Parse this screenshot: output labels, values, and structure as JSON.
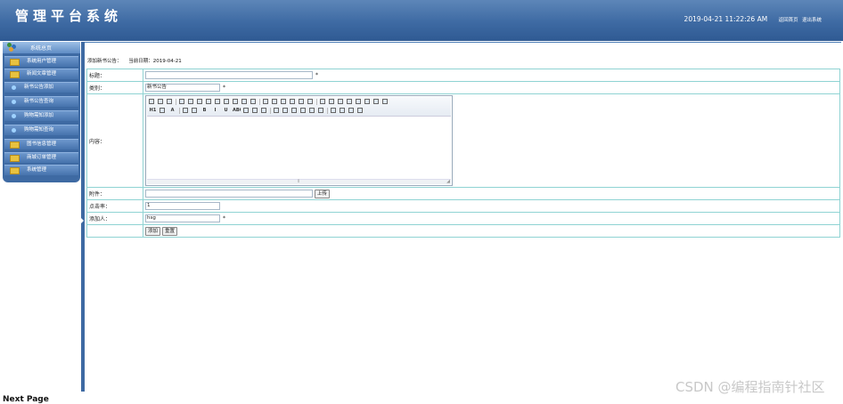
{
  "header": {
    "title": "管理平台系统",
    "datetime": "2019-04-21 11:22:26 AM",
    "links": [
      "返回首页",
      "退出系统"
    ]
  },
  "sidebar": {
    "header_label": "系统总页",
    "items": [
      {
        "label": "系统用户管理",
        "icon": "folder-icon"
      },
      {
        "label": "新闻文章管理",
        "icon": "folder-icon"
      },
      {
        "label": "新书公告添加",
        "icon": "bullet-icon"
      },
      {
        "label": "新书公告查询",
        "icon": "bullet-icon"
      },
      {
        "label": "购物需知添加",
        "icon": "bullet-icon"
      },
      {
        "label": "购物需知查询",
        "icon": "bullet-icon"
      },
      {
        "label": "图书信息管理",
        "icon": "folder-icon"
      },
      {
        "label": "商城订单管理",
        "icon": "folder-icon"
      },
      {
        "label": "系统管理",
        "icon": "folder-icon"
      }
    ]
  },
  "page": {
    "breadcrumb": "添加新书公告：",
    "date_label": "当前日期：",
    "date_value": "2019-04-21"
  },
  "form": {
    "title_label": "标题：",
    "title_value": "",
    "category_label": "类别：",
    "category_value": "新书公告",
    "content_label": "内容：",
    "attachment_label": "附件：",
    "attachment_value": "",
    "upload_label": "上传",
    "clicks_label": "点击率：",
    "clicks_value": "1",
    "author_label": "添加人：",
    "author_value": "hsg",
    "required_mark": "*",
    "submit_label": "添加",
    "reset_label": "重置"
  },
  "editor": {
    "toolbar_row1": [
      "source-icon",
      "undo-icon",
      "redo-icon",
      "new-doc-icon",
      "print-icon",
      "preview-icon",
      "template-icon",
      "cut-icon",
      "copy-icon",
      "paste-icon",
      "paste-text-icon",
      "paste-word-icon",
      "align-left-icon",
      "align-center-icon",
      "align-right-icon",
      "justify-icon",
      "ordered-list-icon",
      "unordered-list-icon",
      "indent-icon",
      "outdent-icon",
      "subscript-icon",
      "superscript-icon",
      "clear-format-icon",
      "select-all-icon",
      "find-icon",
      "fullscreen-icon"
    ],
    "toolbar_row2": [
      "heading-icon",
      "font-family-icon",
      "font-size-icon",
      "font-color-icon",
      "background-color-icon",
      "bold-icon",
      "italic-icon",
      "underline-icon",
      "strike-icon",
      "table-icon",
      "edit-table-icon",
      "image-icon",
      "flash-icon",
      "media-icon",
      "emoticon-icon",
      "special-char-icon",
      "line-icon",
      "anchor-icon",
      "link-icon",
      "unlink-icon",
      "page-break-icon",
      "about-icon"
    ],
    "heading_text": "H1",
    "font_size_text": "A",
    "bold_text": "B",
    "italic_text": "I",
    "underline_text": "U",
    "strike_text": "ABC"
  },
  "watermark": "CSDN @编程指南针社区",
  "bottom_text": "Next Page"
}
